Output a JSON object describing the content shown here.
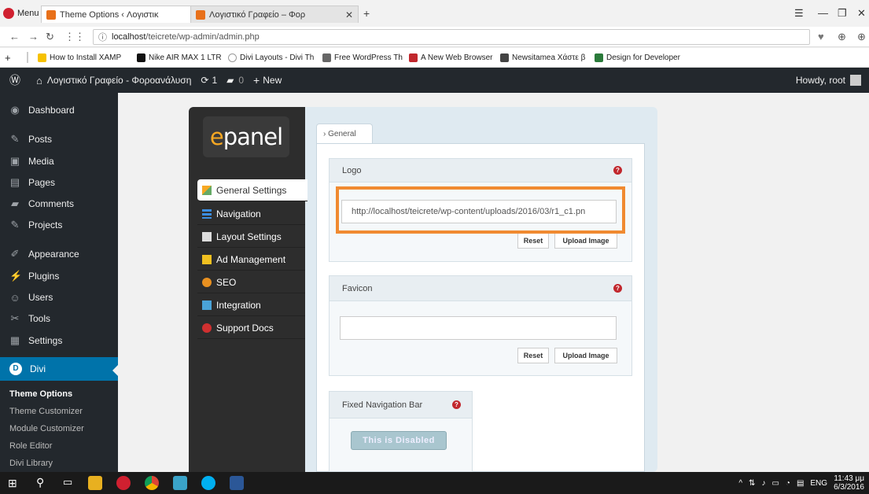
{
  "browser": {
    "menu_label": "Menu",
    "tabs": [
      {
        "title": "Theme Options ‹ Λογιστικ"
      },
      {
        "title": "Λογιστικό Γραφείο – Φορ"
      }
    ],
    "url_host": "localhost",
    "url_path": "/teicrete/wp-admin/admin.php",
    "bookmarks": [
      {
        "label": "How to Install XAMP"
      },
      {
        "label": "Nike AIR MAX 1 LTR"
      },
      {
        "label": "Divi Layouts - Divi Th"
      },
      {
        "label": "Free WordPress Then"
      },
      {
        "label": "A New Web Browser"
      },
      {
        "label": "Newsitamea Χάστε β"
      },
      {
        "label": "Design for Developer"
      }
    ]
  },
  "adminbar": {
    "site_name": "Λογιστικό Γραφείο - Φοροανάλυση",
    "updates": "1",
    "comments": "0",
    "new_label": "New",
    "howdy": "Howdy, root"
  },
  "sidebar": {
    "items": [
      {
        "label": "Dashboard"
      },
      {
        "label": "Posts"
      },
      {
        "label": "Media"
      },
      {
        "label": "Pages"
      },
      {
        "label": "Comments"
      },
      {
        "label": "Projects"
      },
      {
        "label": "Appearance"
      },
      {
        "label": "Plugins"
      },
      {
        "label": "Users"
      },
      {
        "label": "Tools"
      },
      {
        "label": "Settings"
      },
      {
        "label": "Divi"
      }
    ],
    "subitems": [
      {
        "label": "Theme Options"
      },
      {
        "label": "Theme Customizer"
      },
      {
        "label": "Module Customizer"
      },
      {
        "label": "Role Editor"
      },
      {
        "label": "Divi Library"
      }
    ]
  },
  "epanel": {
    "logo_e": "e",
    "logo_rest": "panel",
    "nav": [
      {
        "label": "General Settings"
      },
      {
        "label": "Navigation"
      },
      {
        "label": "Layout Settings"
      },
      {
        "label": "Ad Management"
      },
      {
        "label": "SEO"
      },
      {
        "label": "Integration"
      },
      {
        "label": "Support Docs"
      }
    ],
    "tab_general": "General",
    "logo_box": {
      "title": "Logo",
      "value": "http://localhost/teicrete/wp-content/uploads/2016/03/r1_c1.pn",
      "reset": "Reset",
      "upload": "Upload Image"
    },
    "favicon_box": {
      "title": "Favicon",
      "value": "",
      "reset": "Reset",
      "upload": "Upload Image"
    },
    "fixed_nav_box": {
      "title": "Fixed Navigation Bar",
      "button": "This is Disabled"
    }
  },
  "taskbar": {
    "lang": "ENG",
    "time": "11:43 μμ",
    "date": "6/3/2016"
  },
  "colors": {
    "wp_dark": "#23282d",
    "wp_blue": "#0073aa",
    "highlight": "#f08a31",
    "epanel_orange": "#f7a823"
  }
}
